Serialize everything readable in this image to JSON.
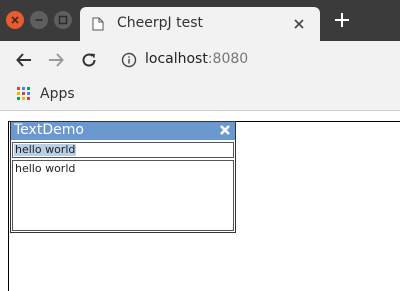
{
  "browser": {
    "tab_title": "CheerpJ test",
    "url_host": "localhost",
    "url_port": ":8080",
    "bookmarks": [
      {
        "label": "Apps"
      }
    ]
  },
  "app": {
    "window_title": "TextDemo",
    "text_field_value": "hello world",
    "text_area_value": "hello world"
  },
  "colors": {
    "close_button": "#e95a2c",
    "java_titlebar": "#6a98cf",
    "selection": "#b8cfe5"
  }
}
